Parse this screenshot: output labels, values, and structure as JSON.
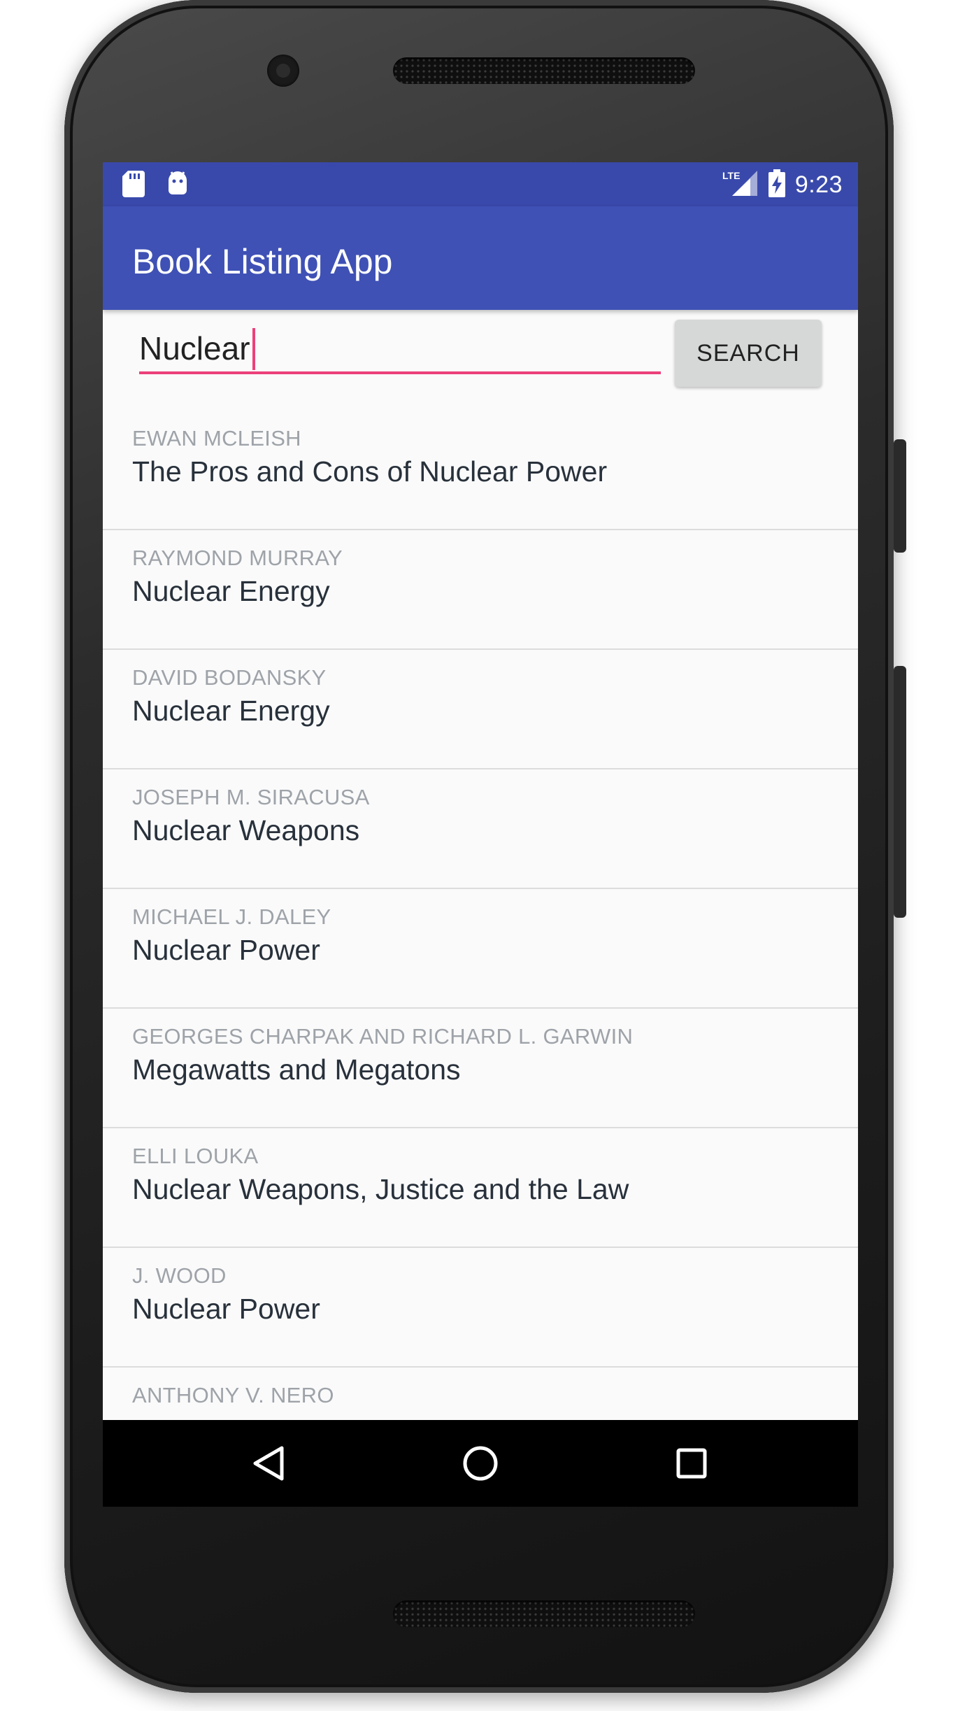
{
  "status_bar": {
    "icons_left": [
      "sd-card-icon",
      "android-debug-icon"
    ],
    "network": "LTE",
    "time": "9:23"
  },
  "app_bar": {
    "title": "Book Listing App"
  },
  "search": {
    "value": "Nuclear",
    "button_label": "SEARCH"
  },
  "books": [
    {
      "author": "Ewan McLeish",
      "title": "The Pros and Cons of Nuclear Power"
    },
    {
      "author": "Raymond Murray",
      "title": "Nuclear Energy"
    },
    {
      "author": "David Bodansky",
      "title": "Nuclear Energy"
    },
    {
      "author": "Joseph M. Siracusa",
      "title": "Nuclear Weapons"
    },
    {
      "author": "Michael J. Daley",
      "title": "Nuclear Power"
    },
    {
      "author": "Georges Charpak and Richard L. Garwin",
      "title": "Megawatts and Megatons"
    },
    {
      "author": "Elli Louka",
      "title": "Nuclear Weapons, Justice and the Law"
    },
    {
      "author": "J. Wood",
      "title": "Nuclear Power"
    },
    {
      "author": "Anthony V. Nero",
      "title": ""
    }
  ],
  "nav_bar": {
    "buttons": [
      "back-icon",
      "home-icon",
      "recents-icon"
    ]
  },
  "colors": {
    "primary": "#3f51b5",
    "primary_dark": "#3949ab",
    "accent": "#ec407a"
  }
}
